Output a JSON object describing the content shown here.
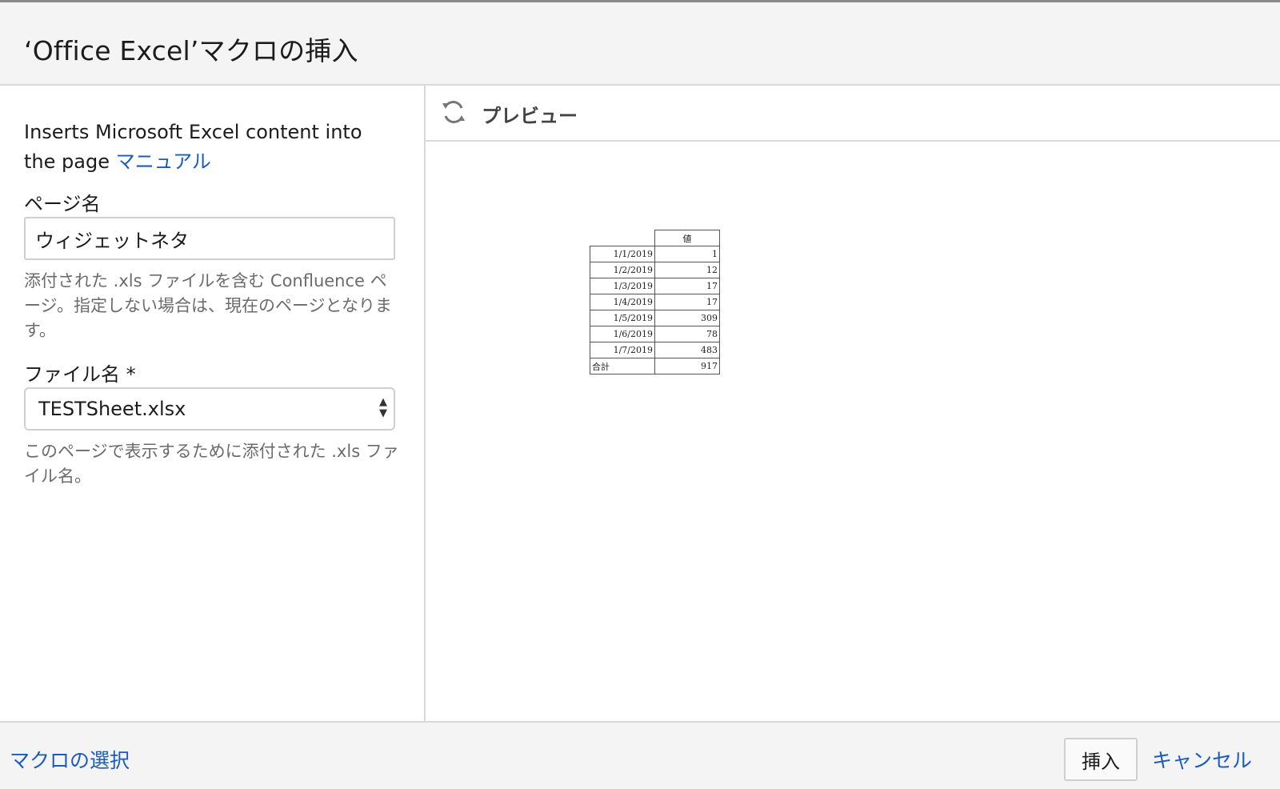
{
  "dialog": {
    "title": "‘Office Excel’マクロの挿入"
  },
  "left_panel": {
    "description": "Inserts Microsoft Excel content into the page",
    "manual_link": "マニュアル",
    "page_name": {
      "label": "ページ名",
      "value": "ウィジェットネタ",
      "help": "添付された .xls ファイルを含む Confluence ページ。指定しない場合は、現在のページとなります。"
    },
    "file_name": {
      "label": "ファイル名 *",
      "selected": "TESTSheet.xlsx",
      "help": "このページで表示するために添付された .xls ファイル名。"
    }
  },
  "preview": {
    "title": "プレビュー",
    "table": {
      "header": "値",
      "rows": [
        {
          "date": "1/1/2019",
          "value": "1"
        },
        {
          "date": "1/2/2019",
          "value": "12"
        },
        {
          "date": "1/3/2019",
          "value": "17"
        },
        {
          "date": "1/4/2019",
          "value": "17"
        },
        {
          "date": "1/5/2019",
          "value": "309"
        },
        {
          "date": "1/6/2019",
          "value": "78"
        },
        {
          "date": "1/7/2019",
          "value": "483"
        }
      ],
      "total_label": "合計",
      "total_value": "917"
    }
  },
  "footer": {
    "select_macro": "マクロの選択",
    "insert": "挿入",
    "cancel": "キャンセル"
  },
  "colors": {
    "link": "#1a5bbd",
    "header_bg": "#f4f4f4"
  }
}
